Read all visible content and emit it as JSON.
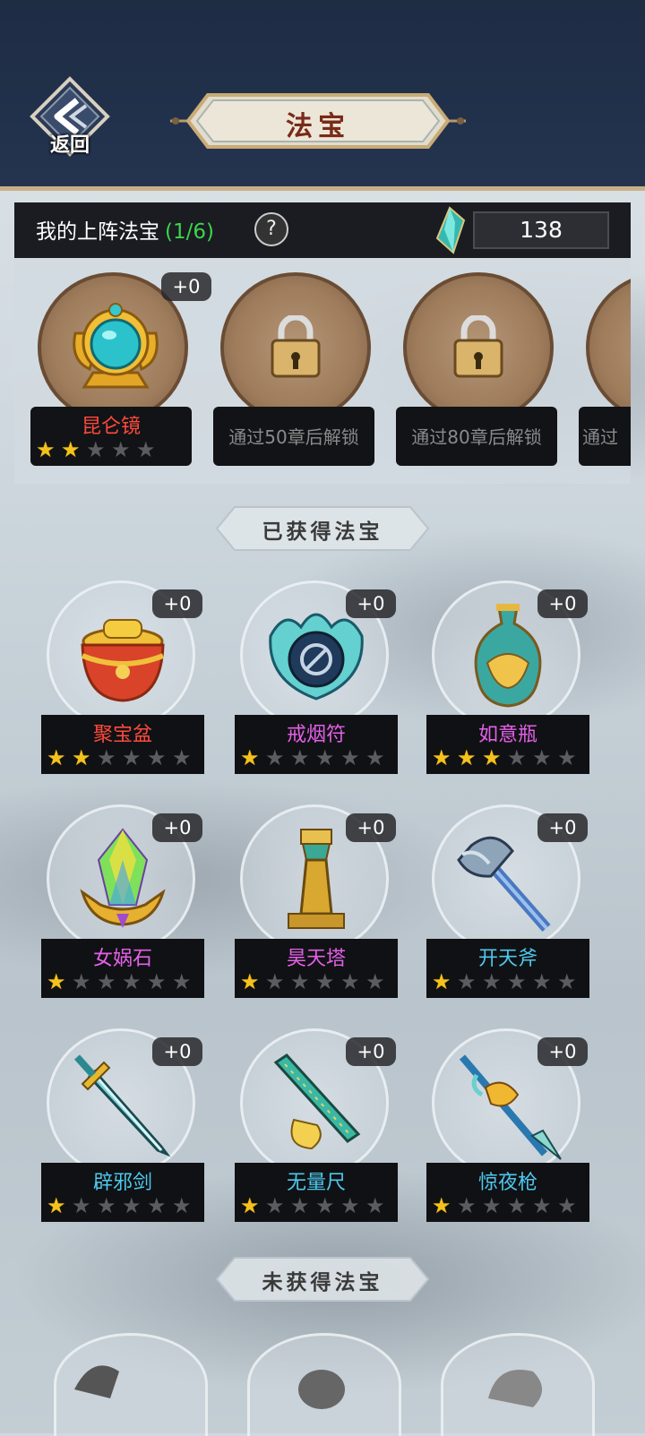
{
  "header": {
    "back_label": "返回",
    "title": "法宝"
  },
  "equipped": {
    "title": "我的上阵法宝",
    "count": "(1/6)",
    "help": "?",
    "gems": "138",
    "slots": [
      {
        "name": "昆仑镜",
        "plus": "+0",
        "stars": 2,
        "max_stars": 5,
        "locked": false
      },
      {
        "lock_text": "通过50章后解锁",
        "locked": true
      },
      {
        "lock_text": "通过80章后解锁",
        "locked": true
      },
      {
        "lock_text": "通过",
        "locked": true
      }
    ]
  },
  "sections": {
    "owned": "已获得法宝",
    "unowned": "未获得法宝"
  },
  "treasures": [
    {
      "name": "聚宝盆",
      "plus": "+0",
      "stars": 2,
      "color": "#ff4a3c",
      "icon": "treasure-bowl-icon"
    },
    {
      "name": "戒烟符",
      "plus": "+0",
      "stars": 1,
      "color": "#e460e8",
      "icon": "no-smoking-talisman-icon"
    },
    {
      "name": "如意瓶",
      "plus": "+0",
      "stars": 3,
      "color": "#e460e8",
      "icon": "vase-icon"
    },
    {
      "name": "女娲石",
      "plus": "+0",
      "stars": 1,
      "color": "#e460e8",
      "icon": "crystal-stone-icon"
    },
    {
      "name": "昊天塔",
      "plus": "+0",
      "stars": 1,
      "color": "#e460e8",
      "icon": "tower-icon"
    },
    {
      "name": "开天斧",
      "plus": "+0",
      "stars": 1,
      "color": "#4ec8ec",
      "icon": "axe-icon"
    },
    {
      "name": "辟邪剑",
      "plus": "+0",
      "stars": 1,
      "color": "#4ec8ec",
      "icon": "sword-icon"
    },
    {
      "name": "无量尺",
      "plus": "+0",
      "stars": 1,
      "color": "#4ec8ec",
      "icon": "ruler-icon"
    },
    {
      "name": "惊夜枪",
      "plus": "+0",
      "stars": 1,
      "color": "#4ec8ec",
      "icon": "spear-icon"
    }
  ],
  "max_stars": 6
}
